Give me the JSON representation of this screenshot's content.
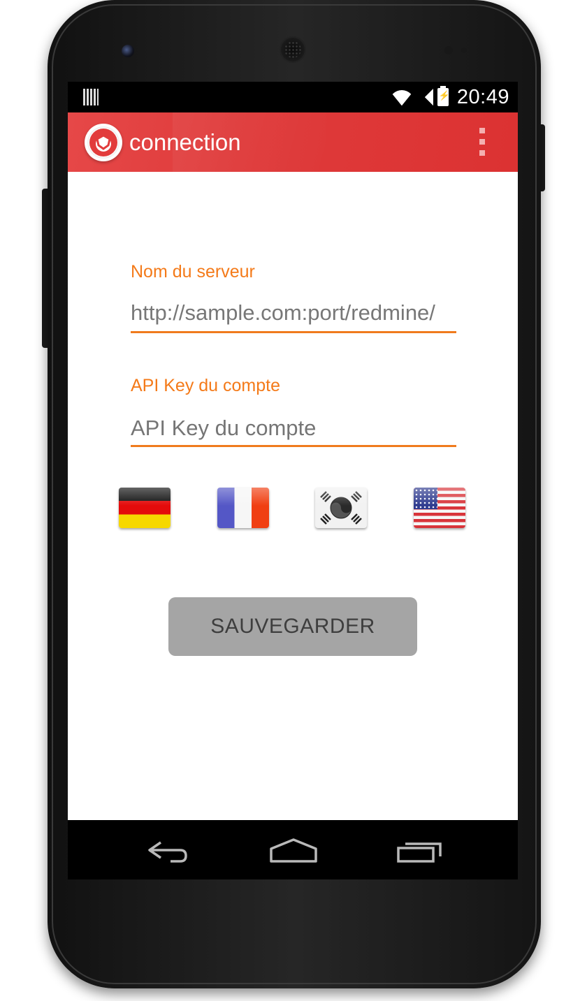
{
  "status_bar": {
    "time": "20:49",
    "icons": [
      "notification-icon",
      "wifi-icon",
      "signal-icon",
      "battery-charging-icon"
    ]
  },
  "app_bar": {
    "title": "connection",
    "logo_icon": "redmine-logo-icon",
    "menu_icon": "overflow-menu-icon",
    "color": "#df3b3b"
  },
  "form": {
    "server": {
      "label": "Nom du serveur",
      "value": "http://sample.com:port/redmine/"
    },
    "api_key": {
      "label": "API Key du compte",
      "placeholder": "API Key du compte"
    },
    "accent_color": "#f47a19"
  },
  "languages": [
    {
      "flag_icon": "flag-germany-icon"
    },
    {
      "flag_icon": "flag-france-icon"
    },
    {
      "flag_icon": "flag-korea-icon"
    },
    {
      "flag_icon": "flag-usa-icon"
    }
  ],
  "save_button": {
    "label": "SAUVEGARDER"
  },
  "nav_bar": {
    "icons": [
      "back-icon",
      "home-icon",
      "recent-apps-icon"
    ]
  }
}
